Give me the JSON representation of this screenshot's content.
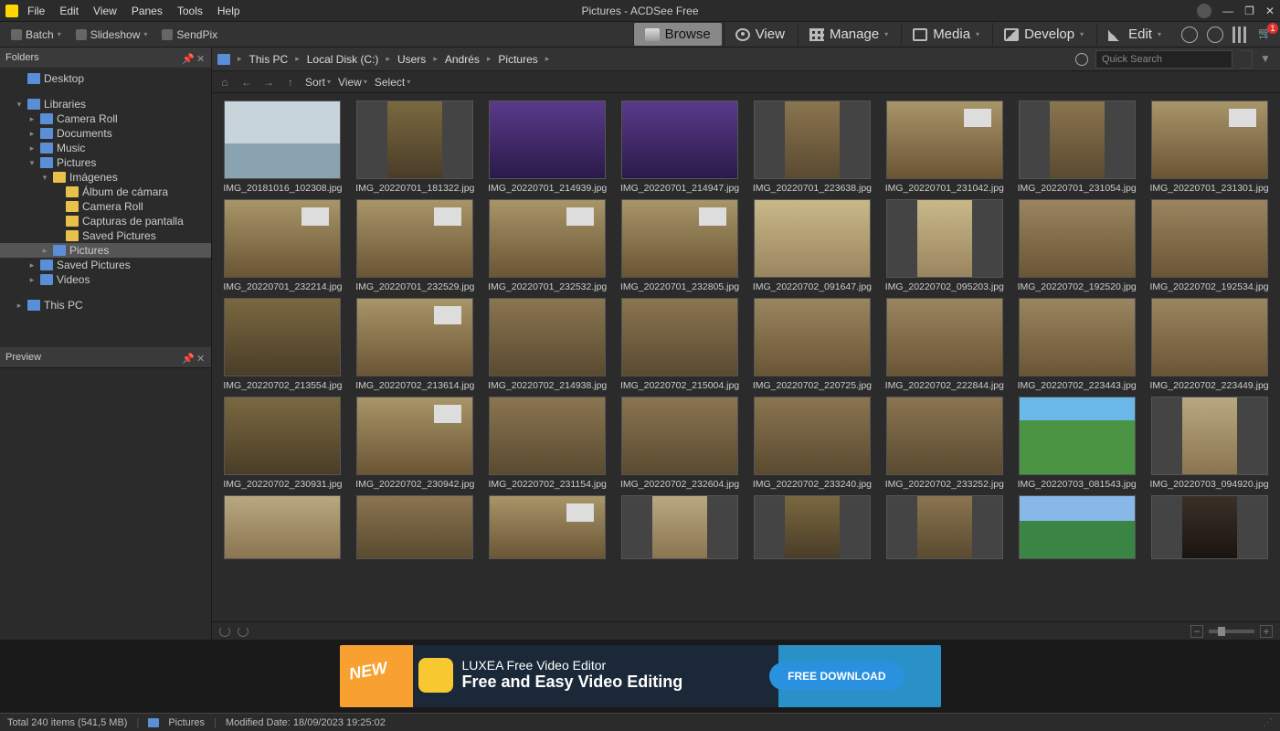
{
  "window": {
    "title": "Pictures - ACDSee Free"
  },
  "menu": [
    "File",
    "Edit",
    "View",
    "Panes",
    "Tools",
    "Help"
  ],
  "tools": {
    "batch": "Batch",
    "slideshow": "Slideshow",
    "sendpix": "SendPix"
  },
  "modes": {
    "browse": "Browse",
    "view": "View",
    "manage": "Manage",
    "media": "Media",
    "develop": "Develop",
    "edit": "Edit"
  },
  "notif_count": "1",
  "panels": {
    "folders": "Folders",
    "preview": "Preview"
  },
  "tree": {
    "desktop": "Desktop",
    "libraries": "Libraries",
    "cameraroll": "Camera Roll",
    "documents": "Documents",
    "music": "Music",
    "pictures": "Pictures",
    "imagenes": "Imágenes",
    "album": "Álbum de cámara",
    "cameraroll2": "Camera Roll",
    "capturas": "Capturas de pantalla",
    "savedpics": "Saved Pictures",
    "pictures2": "Pictures",
    "savedpics2": "Saved Pictures",
    "videos": "Videos",
    "thispc": "This PC"
  },
  "breadcrumb": [
    "This PC",
    "Local Disk (C:)",
    "Users",
    "Andrés",
    "Pictures"
  ],
  "search": {
    "placeholder": "Quick Search"
  },
  "viewbar": {
    "sort": "Sort",
    "view": "View",
    "select": "Select"
  },
  "thumbs": [
    {
      "fn": "IMG_20181016_102308.jpg",
      "c": "c-lake",
      "p": false
    },
    {
      "fn": "IMG_20220701_181322.jpg",
      "c": "c-room1",
      "p": true
    },
    {
      "fn": "IMG_20220701_214939.jpg",
      "c": "c-purple",
      "p": false
    },
    {
      "fn": "IMG_20220701_214947.jpg",
      "c": "c-purple",
      "p": false
    },
    {
      "fn": "IMG_20220701_223638.jpg",
      "c": "c-room2",
      "p": true
    },
    {
      "fn": "IMG_20220701_231042.jpg",
      "c": "c-proj",
      "p": false
    },
    {
      "fn": "IMG_20220701_231054.jpg",
      "c": "c-room2",
      "p": true
    },
    {
      "fn": "IMG_20220701_231301.jpg",
      "c": "c-proj",
      "p": false
    },
    {
      "fn": "IMG_20220701_232214.jpg",
      "c": "c-proj",
      "p": false
    },
    {
      "fn": "IMG_20220701_232529.jpg",
      "c": "c-proj",
      "p": false
    },
    {
      "fn": "IMG_20220701_232532.jpg",
      "c": "c-proj",
      "p": false
    },
    {
      "fn": "IMG_20220701_232805.jpg",
      "c": "c-proj",
      "p": false
    },
    {
      "fn": "IMG_20220702_091647.jpg",
      "c": "c-day",
      "p": false
    },
    {
      "fn": "IMG_20220702_095203.jpg",
      "c": "c-day",
      "p": true
    },
    {
      "fn": "IMG_20220702_192520.jpg",
      "c": "c-room3",
      "p": false
    },
    {
      "fn": "IMG_20220702_192534.jpg",
      "c": "c-room3",
      "p": false
    },
    {
      "fn": "IMG_20220702_213554.jpg",
      "c": "c-room1",
      "p": false
    },
    {
      "fn": "IMG_20220702_213614.jpg",
      "c": "c-proj",
      "p": false
    },
    {
      "fn": "IMG_20220702_214938.jpg",
      "c": "c-room2",
      "p": false
    },
    {
      "fn": "IMG_20220702_215004.jpg",
      "c": "c-room2",
      "p": false
    },
    {
      "fn": "IMG_20220702_220725.jpg",
      "c": "c-room3",
      "p": false
    },
    {
      "fn": "IMG_20220702_222844.jpg",
      "c": "c-room3",
      "p": false
    },
    {
      "fn": "IMG_20220702_223443.jpg",
      "c": "c-room3",
      "p": false
    },
    {
      "fn": "IMG_20220702_223449.jpg",
      "c": "c-room3",
      "p": false
    },
    {
      "fn": "IMG_20220702_230931.jpg",
      "c": "c-room1",
      "p": false
    },
    {
      "fn": "IMG_20220702_230942.jpg",
      "c": "c-proj",
      "p": false
    },
    {
      "fn": "IMG_20220702_231154.jpg",
      "c": "c-room2",
      "p": false
    },
    {
      "fn": "IMG_20220702_232604.jpg",
      "c": "c-room2",
      "p": false
    },
    {
      "fn": "IMG_20220702_233240.jpg",
      "c": "c-room2",
      "p": false
    },
    {
      "fn": "IMG_20220702_233252.jpg",
      "c": "c-room2",
      "p": false
    },
    {
      "fn": "IMG_20220703_081543.jpg",
      "c": "c-pool",
      "p": false
    },
    {
      "fn": "IMG_20220703_094920.jpg",
      "c": "c-indoor",
      "p": true
    },
    {
      "fn": "",
      "c": "c-indoor",
      "p": false
    },
    {
      "fn": "",
      "c": "c-room2",
      "p": false
    },
    {
      "fn": "",
      "c": "c-proj",
      "p": false
    },
    {
      "fn": "",
      "c": "c-indoor",
      "p": true
    },
    {
      "fn": "",
      "c": "c-room1",
      "p": true
    },
    {
      "fn": "",
      "c": "c-room2",
      "p": true
    },
    {
      "fn": "",
      "c": "c-field",
      "p": false
    },
    {
      "fn": "",
      "c": "c-dark",
      "p": true
    }
  ],
  "ad": {
    "new": "NEW",
    "line1": "LUXEA Free Video Editor",
    "line2": "Free and Easy Video Editing",
    "btn": "FREE DOWNLOAD"
  },
  "status": {
    "items": "Total 240 items  (541,5 MB)",
    "folder": "Pictures",
    "modified": "Modified Date: 18/09/2023 19:25:02"
  }
}
